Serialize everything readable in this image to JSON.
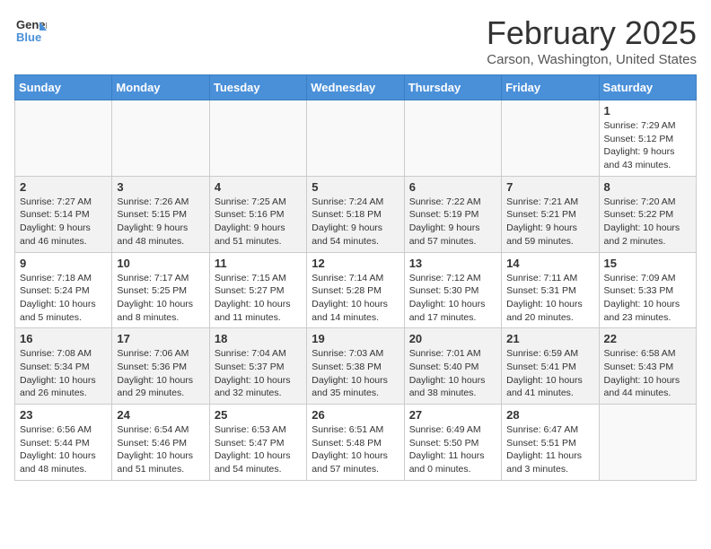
{
  "header": {
    "logo_general": "General",
    "logo_blue": "Blue",
    "month_year": "February 2025",
    "location": "Carson, Washington, United States"
  },
  "weekdays": [
    "Sunday",
    "Monday",
    "Tuesday",
    "Wednesday",
    "Thursday",
    "Friday",
    "Saturday"
  ],
  "weeks": [
    [
      {
        "day": "",
        "info": ""
      },
      {
        "day": "",
        "info": ""
      },
      {
        "day": "",
        "info": ""
      },
      {
        "day": "",
        "info": ""
      },
      {
        "day": "",
        "info": ""
      },
      {
        "day": "",
        "info": ""
      },
      {
        "day": "1",
        "info": "Sunrise: 7:29 AM\nSunset: 5:12 PM\nDaylight: 9 hours and 43 minutes."
      }
    ],
    [
      {
        "day": "2",
        "info": "Sunrise: 7:27 AM\nSunset: 5:14 PM\nDaylight: 9 hours and 46 minutes."
      },
      {
        "day": "3",
        "info": "Sunrise: 7:26 AM\nSunset: 5:15 PM\nDaylight: 9 hours and 48 minutes."
      },
      {
        "day": "4",
        "info": "Sunrise: 7:25 AM\nSunset: 5:16 PM\nDaylight: 9 hours and 51 minutes."
      },
      {
        "day": "5",
        "info": "Sunrise: 7:24 AM\nSunset: 5:18 PM\nDaylight: 9 hours and 54 minutes."
      },
      {
        "day": "6",
        "info": "Sunrise: 7:22 AM\nSunset: 5:19 PM\nDaylight: 9 hours and 57 minutes."
      },
      {
        "day": "7",
        "info": "Sunrise: 7:21 AM\nSunset: 5:21 PM\nDaylight: 9 hours and 59 minutes."
      },
      {
        "day": "8",
        "info": "Sunrise: 7:20 AM\nSunset: 5:22 PM\nDaylight: 10 hours and 2 minutes."
      }
    ],
    [
      {
        "day": "9",
        "info": "Sunrise: 7:18 AM\nSunset: 5:24 PM\nDaylight: 10 hours and 5 minutes."
      },
      {
        "day": "10",
        "info": "Sunrise: 7:17 AM\nSunset: 5:25 PM\nDaylight: 10 hours and 8 minutes."
      },
      {
        "day": "11",
        "info": "Sunrise: 7:15 AM\nSunset: 5:27 PM\nDaylight: 10 hours and 11 minutes."
      },
      {
        "day": "12",
        "info": "Sunrise: 7:14 AM\nSunset: 5:28 PM\nDaylight: 10 hours and 14 minutes."
      },
      {
        "day": "13",
        "info": "Sunrise: 7:12 AM\nSunset: 5:30 PM\nDaylight: 10 hours and 17 minutes."
      },
      {
        "day": "14",
        "info": "Sunrise: 7:11 AM\nSunset: 5:31 PM\nDaylight: 10 hours and 20 minutes."
      },
      {
        "day": "15",
        "info": "Sunrise: 7:09 AM\nSunset: 5:33 PM\nDaylight: 10 hours and 23 minutes."
      }
    ],
    [
      {
        "day": "16",
        "info": "Sunrise: 7:08 AM\nSunset: 5:34 PM\nDaylight: 10 hours and 26 minutes."
      },
      {
        "day": "17",
        "info": "Sunrise: 7:06 AM\nSunset: 5:36 PM\nDaylight: 10 hours and 29 minutes."
      },
      {
        "day": "18",
        "info": "Sunrise: 7:04 AM\nSunset: 5:37 PM\nDaylight: 10 hours and 32 minutes."
      },
      {
        "day": "19",
        "info": "Sunrise: 7:03 AM\nSunset: 5:38 PM\nDaylight: 10 hours and 35 minutes."
      },
      {
        "day": "20",
        "info": "Sunrise: 7:01 AM\nSunset: 5:40 PM\nDaylight: 10 hours and 38 minutes."
      },
      {
        "day": "21",
        "info": "Sunrise: 6:59 AM\nSunset: 5:41 PM\nDaylight: 10 hours and 41 minutes."
      },
      {
        "day": "22",
        "info": "Sunrise: 6:58 AM\nSunset: 5:43 PM\nDaylight: 10 hours and 44 minutes."
      }
    ],
    [
      {
        "day": "23",
        "info": "Sunrise: 6:56 AM\nSunset: 5:44 PM\nDaylight: 10 hours and 48 minutes."
      },
      {
        "day": "24",
        "info": "Sunrise: 6:54 AM\nSunset: 5:46 PM\nDaylight: 10 hours and 51 minutes."
      },
      {
        "day": "25",
        "info": "Sunrise: 6:53 AM\nSunset: 5:47 PM\nDaylight: 10 hours and 54 minutes."
      },
      {
        "day": "26",
        "info": "Sunrise: 6:51 AM\nSunset: 5:48 PM\nDaylight: 10 hours and 57 minutes."
      },
      {
        "day": "27",
        "info": "Sunrise: 6:49 AM\nSunset: 5:50 PM\nDaylight: 11 hours and 0 minutes."
      },
      {
        "day": "28",
        "info": "Sunrise: 6:47 AM\nSunset: 5:51 PM\nDaylight: 11 hours and 3 minutes."
      },
      {
        "day": "",
        "info": ""
      }
    ]
  ]
}
